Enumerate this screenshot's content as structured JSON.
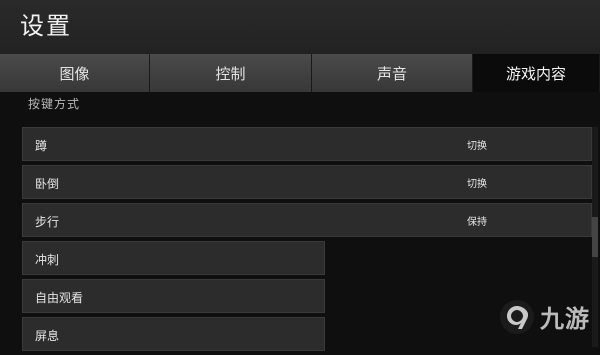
{
  "header": {
    "title": "设置"
  },
  "tabs": [
    {
      "label": "图像",
      "active": false
    },
    {
      "label": "控制",
      "active": false
    },
    {
      "label": "声音",
      "active": false
    },
    {
      "label": "游戏内容",
      "active": true
    }
  ],
  "section": {
    "label": "按键方式"
  },
  "settings": [
    {
      "label": "蹲",
      "value": "切换"
    },
    {
      "label": "卧倒",
      "value": "切换"
    },
    {
      "label": "步行",
      "value": "保持"
    },
    {
      "label": "冲刺",
      "value": ""
    },
    {
      "label": "自由观看",
      "value": ""
    },
    {
      "label": "屏息",
      "value": ""
    }
  ],
  "watermark": {
    "text": "九游",
    "icon": "nine-game-logo-icon"
  }
}
